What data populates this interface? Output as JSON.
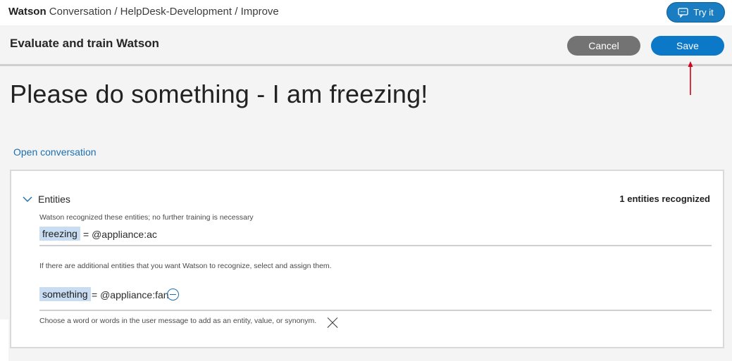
{
  "breadcrumb": {
    "brand": "Watson",
    "path": " Conversation / HelpDesk-Development / Improve"
  },
  "try_it": {
    "label": "Try it",
    "icon": "chat-bubble-icon"
  },
  "header": {
    "title": "Evaluate and train Watson",
    "cancel_label": "Cancel",
    "save_label": "Save"
  },
  "utterance": "Please do something - I am freezing!",
  "open_conversation": "Open conversation",
  "entities": {
    "heading": "Entities",
    "count_text": "1 entities recognized",
    "recognized_note": "Watson recognized these entities; no further training is necessary",
    "recognized": [
      {
        "word": "freezing",
        "value": "= @appliance:ac"
      }
    ],
    "additional_note": "If there are additional entities that you want Watson to recognize, select and assign them.",
    "assigned": [
      {
        "word": "something",
        "value": "= @appliance:fan"
      }
    ],
    "hint": "Choose a word or words in the user message to add as an entity, value, or synonym."
  },
  "colors": {
    "accent": "#0b78c8",
    "cancel": "#737373",
    "chip": "#c8dcf2",
    "annotation_arrow": "#d0021b"
  }
}
